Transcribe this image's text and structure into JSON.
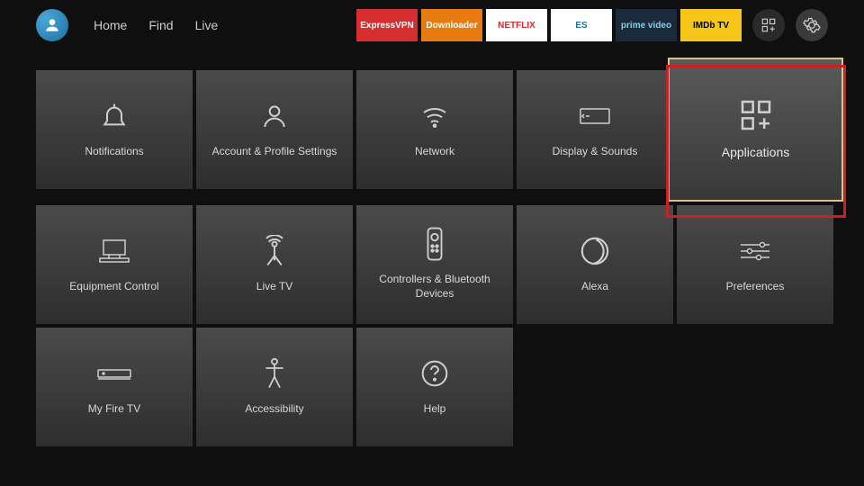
{
  "nav": {
    "tabs": [
      "Home",
      "Find",
      "Live"
    ]
  },
  "apps": [
    {
      "name": "ExpressVPN",
      "bg": "#d62e2e",
      "color": "#fff"
    },
    {
      "name": "Downloader",
      "bg": "#e87b0f",
      "color": "#fff"
    },
    {
      "name": "NETFLIX",
      "bg": "#ffffff",
      "color": "#d62e2e"
    },
    {
      "name": "ES",
      "bg": "#ffffff",
      "color": "#1d6fa5"
    },
    {
      "name": "prime video",
      "bg": "#1a2a3a",
      "color": "#7fd1e8"
    },
    {
      "name": "IMDb TV",
      "bg": "#f5c518",
      "color": "#000"
    }
  ],
  "settings": {
    "tiles": [
      {
        "id": "notifications",
        "label": "Notifications",
        "icon": "bell"
      },
      {
        "id": "account",
        "label": "Account & Profile Settings",
        "icon": "user"
      },
      {
        "id": "network",
        "label": "Network",
        "icon": "wifi"
      },
      {
        "id": "display",
        "label": "Display & Sounds",
        "icon": "display"
      },
      {
        "id": "applications",
        "label": "Applications",
        "icon": "apps",
        "selected": true
      },
      {
        "id": "equipment",
        "label": "Equipment Control",
        "icon": "equipment"
      },
      {
        "id": "livetv",
        "label": "Live TV",
        "icon": "antenna"
      },
      {
        "id": "controllers",
        "label": "Controllers & Bluetooth Devices",
        "icon": "remote"
      },
      {
        "id": "alexa",
        "label": "Alexa",
        "icon": "alexa"
      },
      {
        "id": "preferences",
        "label": "Preferences",
        "icon": "sliders"
      },
      {
        "id": "myfiretv",
        "label": "My Fire TV",
        "icon": "firetv"
      },
      {
        "id": "accessibility",
        "label": "Accessibility",
        "icon": "accessibility"
      },
      {
        "id": "help",
        "label": "Help",
        "icon": "help"
      }
    ]
  }
}
